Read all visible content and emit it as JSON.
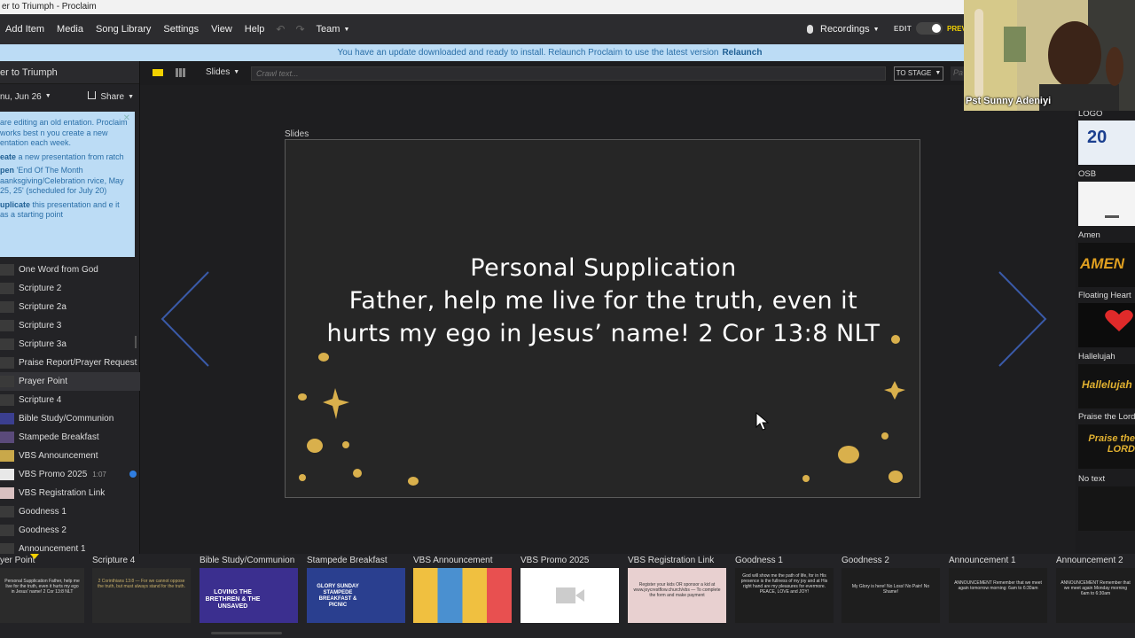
{
  "window": {
    "title": "er to Triumph - Proclaim"
  },
  "menu": {
    "items": [
      "Add Item",
      "Media",
      "Song Library",
      "Settings",
      "View",
      "Help"
    ],
    "team": "Team",
    "recordings": "Recordings",
    "edit": "EDIT",
    "preview": "PREV"
  },
  "update_bar": {
    "message": "You have an update downloaded and ready to install. Relaunch Proclaim to use the latest version",
    "action": "Relaunch"
  },
  "sidebar": {
    "presentation_title": "er to Triumph",
    "date": "nu, Jun 26",
    "share": "Share",
    "notice": {
      "intro": "are editing an old entation. Proclaim works best n you create a new entation each week.",
      "create_bold": "eate",
      "create_rest": " a new presentation from ratch",
      "open_bold": "pen",
      "open_rest": " 'End Of The Month aanksgiving/Celebration rvice, May 25, 25' (scheduled for July 20)",
      "dup_bold": "uplicate",
      "dup_rest": " this presentation and e it as a starting point"
    },
    "items": [
      {
        "label": "One Word from God"
      },
      {
        "label": "Scripture 2"
      },
      {
        "label": "Scripture 2a"
      },
      {
        "label": "Scripture 3"
      },
      {
        "label": "Scripture 3a"
      },
      {
        "label": "Praise Report/Prayer Request"
      },
      {
        "label": "Prayer Point"
      },
      {
        "label": "Scripture 4"
      },
      {
        "label": "Bible Study/Communion"
      },
      {
        "label": "Stampede Breakfast"
      },
      {
        "label": "VBS Announcement"
      },
      {
        "label": "VBS Promo 2025",
        "duration": "1:07"
      },
      {
        "label": "VBS Registration Link"
      },
      {
        "label": "Goodness 1"
      },
      {
        "label": "Goodness 2"
      },
      {
        "label": "Announcement 1"
      }
    ]
  },
  "toolbar": {
    "slides": "Slides",
    "crawl_placeholder": "Crawl text...",
    "to_stage": "TO STAGE",
    "pa": "Pa"
  },
  "main": {
    "slides_label": "Slides",
    "slide_text_1": "Personal Supplication",
    "slide_text_2": "Father, help me live for the truth, even it hurts my ego in Jesus’ name! 2 Cor 13:8 NLT"
  },
  "right_panel": {
    "items": [
      {
        "label": "LOGO",
        "thumb_text": "20"
      },
      {
        "label": "OSB",
        "thumb_text": ""
      },
      {
        "label": "Amen",
        "thumb_text": "AMEN"
      },
      {
        "label": "Floating Heart",
        "thumb_text": ""
      },
      {
        "label": "Hallelujah",
        "thumb_text": "Hallelujah"
      },
      {
        "label": "Praise the Lord",
        "thumb_text": "Praise the LORD"
      },
      {
        "label": "No text",
        "thumb_text": ""
      }
    ]
  },
  "webcam": {
    "name": "Pst Sunny Adeniyi"
  },
  "filmstrip": {
    "items": [
      {
        "label": "yer Point",
        "thumb_text": "Personal Supplication Father, help me live for the truth, even it hurts my ego in Jesus' name! 2 Cor 13:8 NLT"
      },
      {
        "label": "Scripture 4",
        "thumb_text": "2 Corinthians 13:8 — For we cannot oppose the truth, but must always stand for the truth."
      },
      {
        "label": "Bible Study/Communion",
        "thumb_text": "LOVING THE BRETHREN & THE UNSAVED"
      },
      {
        "label": "Stampede Breakfast",
        "thumb_text": "GLORY SUNDAY STAMPEDE BREAKFAST & PICNIC"
      },
      {
        "label": "VBS Announcement",
        "thumb_text": ""
      },
      {
        "label": "VBS Promo 2025",
        "thumb_text": ""
      },
      {
        "label": "VBS Registration Link",
        "thumb_text": "Register your kids OR sponsor a kid at www.joycrestflow.church/vbs — To complete the form and make payment"
      },
      {
        "label": "Goodness 1",
        "thumb_text": "God will show me the path of life, for in His presence is the fullness of my joy and at His right hand are my pleasures for evermore. PEACE, LOVE and JOY!"
      },
      {
        "label": "Goodness 2",
        "thumb_text": "My Glory is here! No Loss! No Pain! No Shame!"
      },
      {
        "label": "Announcement 1",
        "thumb_text": "ANNOUNCEMENT Remember that we meet again tomorrow morning: 6am to 6:30am"
      },
      {
        "label": "Announcement 2",
        "thumb_text": "ANNOUNCEMENT Remember that we meet again Monday morning 6am to 6:30am"
      }
    ]
  },
  "colors": {
    "accent": "#f2d100",
    "update_bg": "#bcdcf5",
    "link_blue": "#2f7de0",
    "slide_bg": "#262626"
  }
}
